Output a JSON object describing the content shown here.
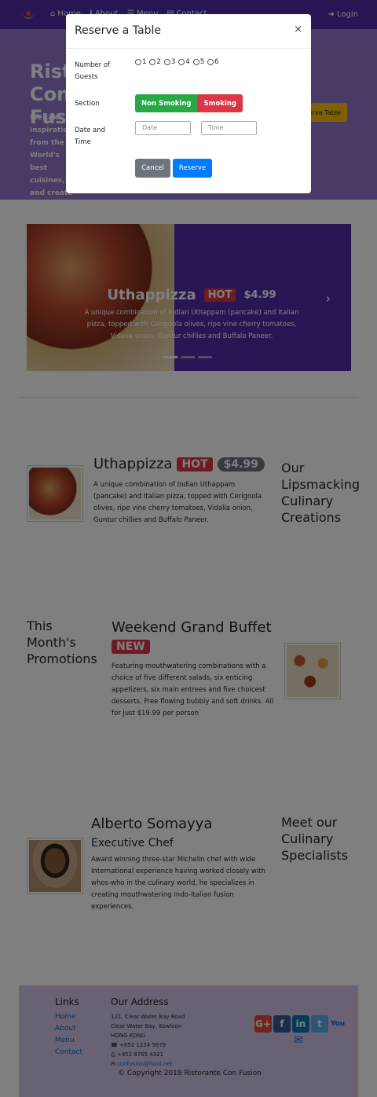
{
  "navbar": {
    "items": [
      {
        "label": "Home",
        "icon": "home-icon"
      },
      {
        "label": "About",
        "icon": "info-icon"
      },
      {
        "label": "Menu",
        "icon": "list-icon"
      },
      {
        "label": "Contact",
        "icon": "address-card-icon"
      }
    ],
    "login_label": "Login"
  },
  "jumbotron": {
    "title": "Ristorante Con Fusion",
    "text": "We take inspiration from the World's best cuisines, and create a unique fusion experience. Our lipsmacking creations will tickle your culinary senses!",
    "reserve_label": "Reserve Table"
  },
  "carousel": {
    "name": "Uthappizza",
    "badge": "HOT",
    "price": "$4.99",
    "description": "A unique combination of Indian Uthappam (pancake) and Italian pizza, topped with Cerignola olives, ripe vine cherry tomatoes, Vidalia onion, Guntur chillies and Buffalo Paneer."
  },
  "dish": {
    "name": "Uthappizza",
    "badge": "HOT",
    "price": "$4.99",
    "description": "A unique combination of Indian Uthappam (pancake) and Italian pizza, topped with Cerignola olives, ripe vine cherry tomatoes, Vidalia onion, Guntur chillies and Buffalo Paneer.",
    "side_title": "Our Lipsmacking Culinary Creations"
  },
  "promotion": {
    "side_title": "This Month's Promotions",
    "name": "Weekend Grand Buffet",
    "badge": "NEW",
    "description": "Featuring mouthwatering combinations with a choice of five different salads, six enticing appetizers, six main entrees and five choicest desserts. Free flowing bubbly and soft drinks. All for just $19.99 per person"
  },
  "leader": {
    "name": "Alberto Somayya",
    "designation": "Executive Chef",
    "description": "Award winning three-star Michelin chef with wide International experience having worked closely with whos-who in the culinary world, he specializes in creating mouthwatering Indo-Italian fusion experiences.",
    "side_title": "Meet our Culinary Specialists"
  },
  "footer": {
    "links_heading": "Links",
    "links": [
      "Home",
      "About",
      "Menu",
      "Contact"
    ],
    "address_heading": "Our Address",
    "address_lines": [
      "121, Clear Water Bay Road",
      "Clear Water Bay, Kowloon",
      "HONG KONG"
    ],
    "phone": "+852 1234 5678",
    "fax": "+852 8765 4321",
    "email": "confusion@food.net",
    "copyright": "© Copyright 2018 Ristorante Con Fusion"
  },
  "modal": {
    "title": "Reserve a Table",
    "close": "×",
    "guests_label": "Number of Guests",
    "guest_options": [
      "1",
      "2",
      "3",
      "4",
      "5",
      "6"
    ],
    "section_label": "Section",
    "section_options": [
      "Non Smoking",
      "Smoking"
    ],
    "datetime_label": "Date and Time",
    "date_placeholder": "Date",
    "time_placeholder": "Time",
    "cancel_label": "Cancel",
    "reserve_label": "Reserve"
  },
  "colors": {
    "primary": "#512da8",
    "jumbotron": "#9575cd",
    "footer": "#d1c4e9",
    "danger": "#dc3545",
    "success": "#28a745",
    "btn_primary": "#007bff",
    "btn_secondary": "#6c757d"
  }
}
